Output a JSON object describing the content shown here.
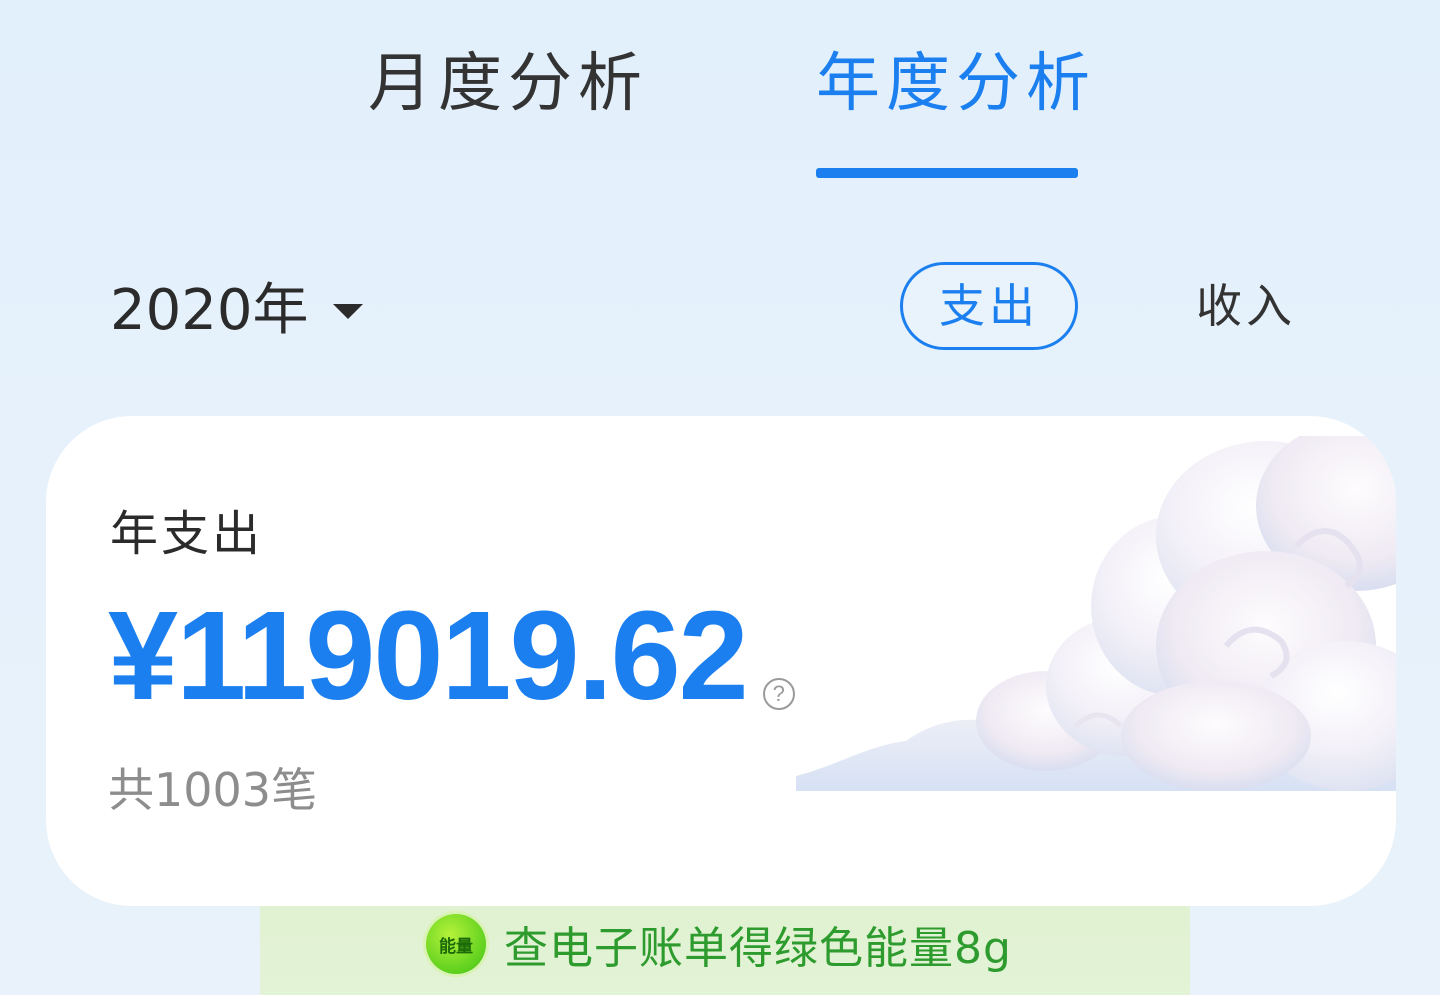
{
  "tabs": {
    "month": "月度分析",
    "year": "年度分析",
    "active": "year",
    "active_color": "#1b7ff0"
  },
  "filter": {
    "year_label": "2020年",
    "caret_icon": "caret-down-icon",
    "segment_expense": "支出",
    "segment_income": "收入",
    "selected_segment": "expense"
  },
  "summary": {
    "label": "年支出",
    "amount": "¥119019.62",
    "help_icon": "question-circle-icon",
    "help_glyph": "?",
    "count": "共1003笔",
    "amount_color": "#1b7ff0"
  },
  "energy": {
    "badge_text": "能量",
    "text": "查电子账单得绿色能量8g",
    "text_color": "#2e9b2e"
  }
}
